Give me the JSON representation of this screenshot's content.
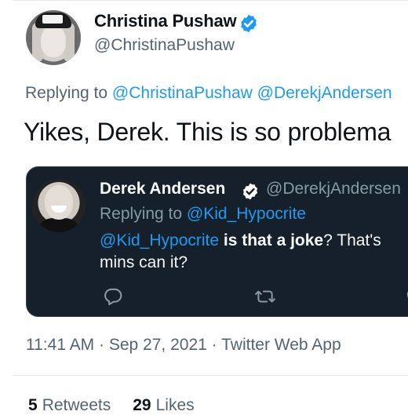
{
  "author": {
    "name": "Christina Pushaw",
    "handle": "@ChristinaPushaw"
  },
  "reply_context": {
    "prefix": "Replying to",
    "mention_1": "@ChristinaPushaw",
    "mention_2": "@DerekjAndersen"
  },
  "tweet_text": "Yikes, Derek. This is so problema",
  "quoted": {
    "name": "Derek Andersen",
    "handle": "@DerekjAndersen",
    "replying_prefix": "Replying to",
    "replying_mention": "@Kid_Hypocrite",
    "text_mention": "@Kid_Hypocrite",
    "text_bold": "is that a joke",
    "text_rest": "? That's",
    "text_line2": "mins can it?"
  },
  "meta": {
    "time": "11:41 AM",
    "separator": "·",
    "date": "Sep 27, 2021",
    "client": "Twitter Web App"
  },
  "stats": {
    "retweets_count": "5",
    "retweets_label": "Retweets",
    "likes_count": "29",
    "likes_label": "Likes"
  },
  "colors": {
    "accent": "#1d9bf0",
    "quote_bg": "#15202b",
    "muted_text": "#536471"
  },
  "icons": [
    "verified-badge-icon",
    "reply-icon",
    "retweet-icon",
    "like-icon"
  ]
}
